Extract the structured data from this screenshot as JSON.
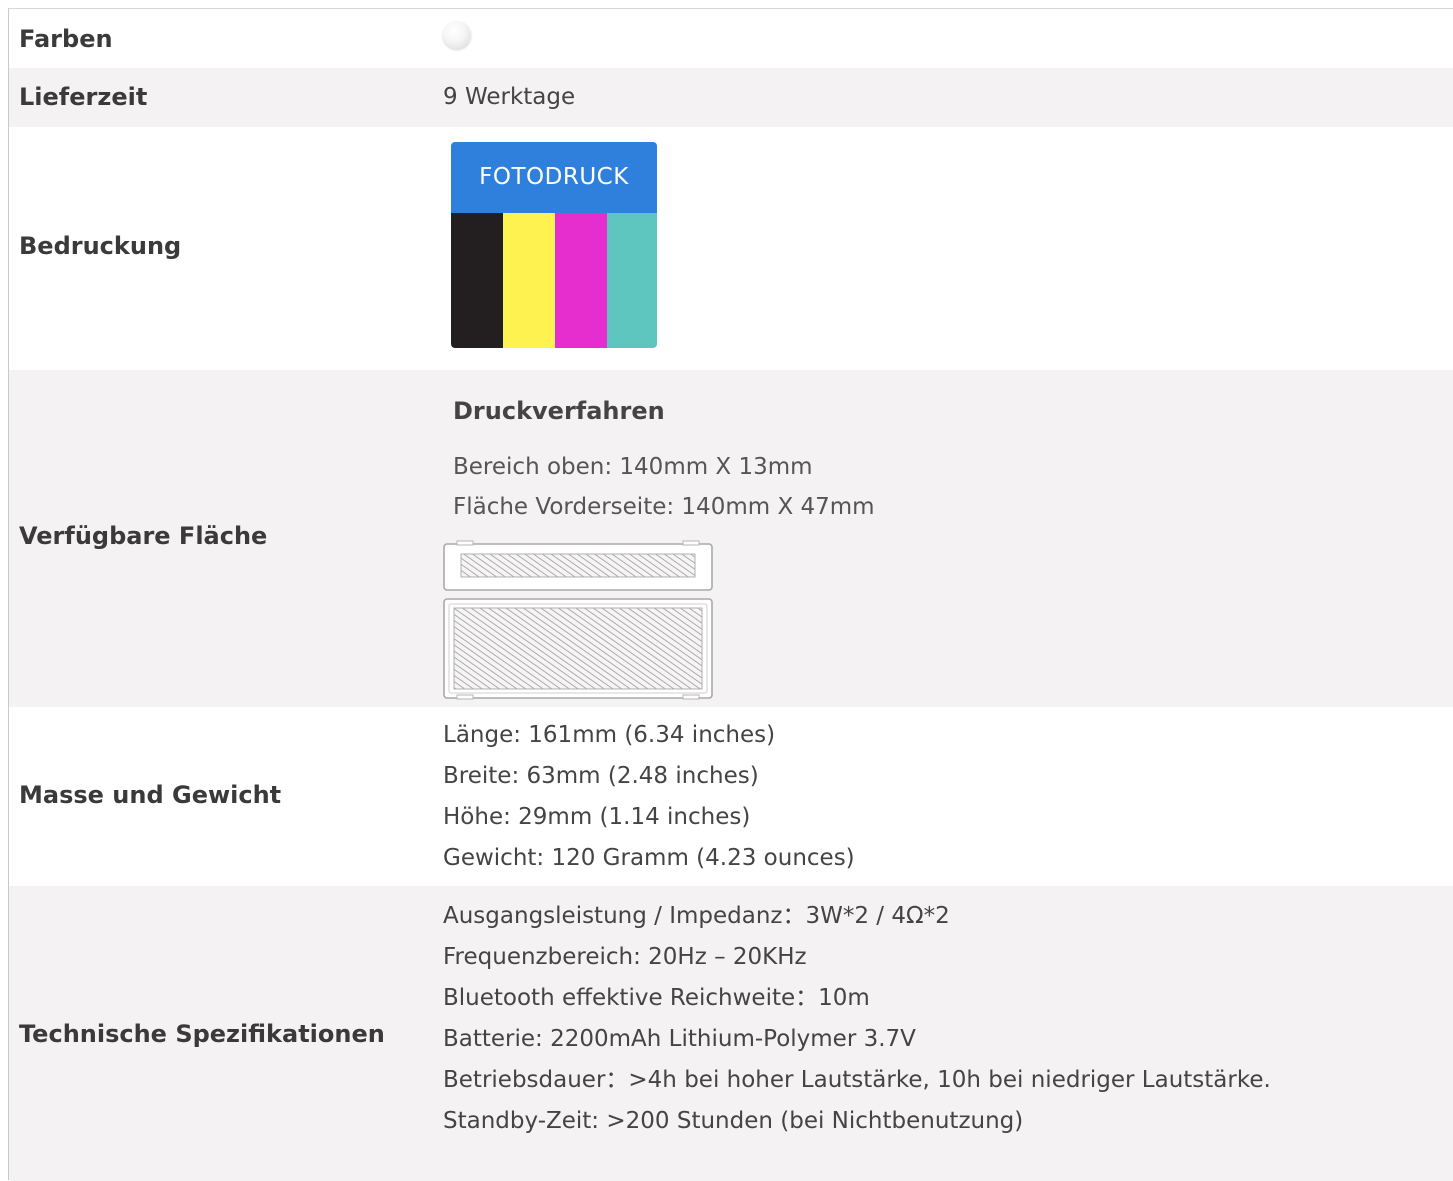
{
  "rows": {
    "farben": {
      "label": "Farben",
      "swatch_color": "#ffffff"
    },
    "lieferzeit": {
      "label": "Lieferzeit",
      "value": "9 Werktage"
    },
    "bedruckung": {
      "label": "Bedruckung",
      "badge_title": "FOTODRUCK",
      "badge_header_color": "#2f80dc",
      "stripe_colors": [
        "#231f20",
        "#fdf24f",
        "#e62ecf",
        "#5ec6be"
      ]
    },
    "flaeche": {
      "label": "Verfügbare Fläche",
      "title": "Druckverfahren",
      "lines": [
        "Bereich oben: 140mm X 13mm",
        "Fläche Vorderseite: 140mm X 47mm"
      ]
    },
    "masse": {
      "label": "Masse und Gewicht",
      "lines": [
        "Länge: 161mm (6.34 inches)",
        "Breite: 63mm (2.48 inches)",
        "Höhe: 29mm (1.14 inches)",
        "Gewicht: 120 Gramm (4.23 ounces)"
      ]
    },
    "technik": {
      "label": "Technische Spezifikationen",
      "lines": [
        "Ausgangsleistung / Impedanz：3W*2 / 4Ω*2",
        "Frequenzbereich: 20Hz – 20KHz",
        "Bluetooth effektive Reichweite：10m",
        "Batterie: 2200mAh Lithium-Polymer 3.7V",
        "Betriebsdauer：>4h bei hoher Lautstärke, 10h bei niedriger Lautstärke.",
        "Standby-Zeit: >200 Stunden (bei Nichtbenutzung)"
      ]
    }
  }
}
